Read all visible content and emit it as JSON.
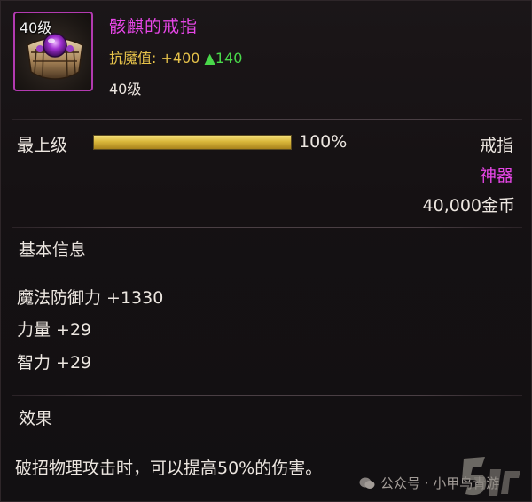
{
  "item": {
    "icon_level": "40级",
    "name": "骸麒的戒指",
    "resist_label": "抗魔值:",
    "resist_value": "+400",
    "resist_up_symbol": "▲",
    "resist_up_value": "140",
    "level": "40级",
    "icon": "purple-gem-ring-icon"
  },
  "upgrade": {
    "label": "最上级",
    "progress_percent": 100,
    "percent_text": "100%"
  },
  "info": {
    "type": "戒指",
    "rarity": "神器",
    "price": "40,000金币"
  },
  "basic_info": {
    "title": "基本信息",
    "stats": [
      "魔法防御力 +1330",
      "力量 +29",
      "智力 +29"
    ]
  },
  "effect": {
    "title": "效果",
    "text": "破招物理攻击时，可以提高50%的伤害。"
  },
  "watermark": {
    "text": "公众号 · 小甲鸟青游"
  },
  "colors": {
    "name_color": "#e646e6",
    "resist_color": "#e6c24a",
    "up_color": "#49d84a",
    "bar_color": "#d9b63a",
    "icon_border": "#b23ab0"
  }
}
